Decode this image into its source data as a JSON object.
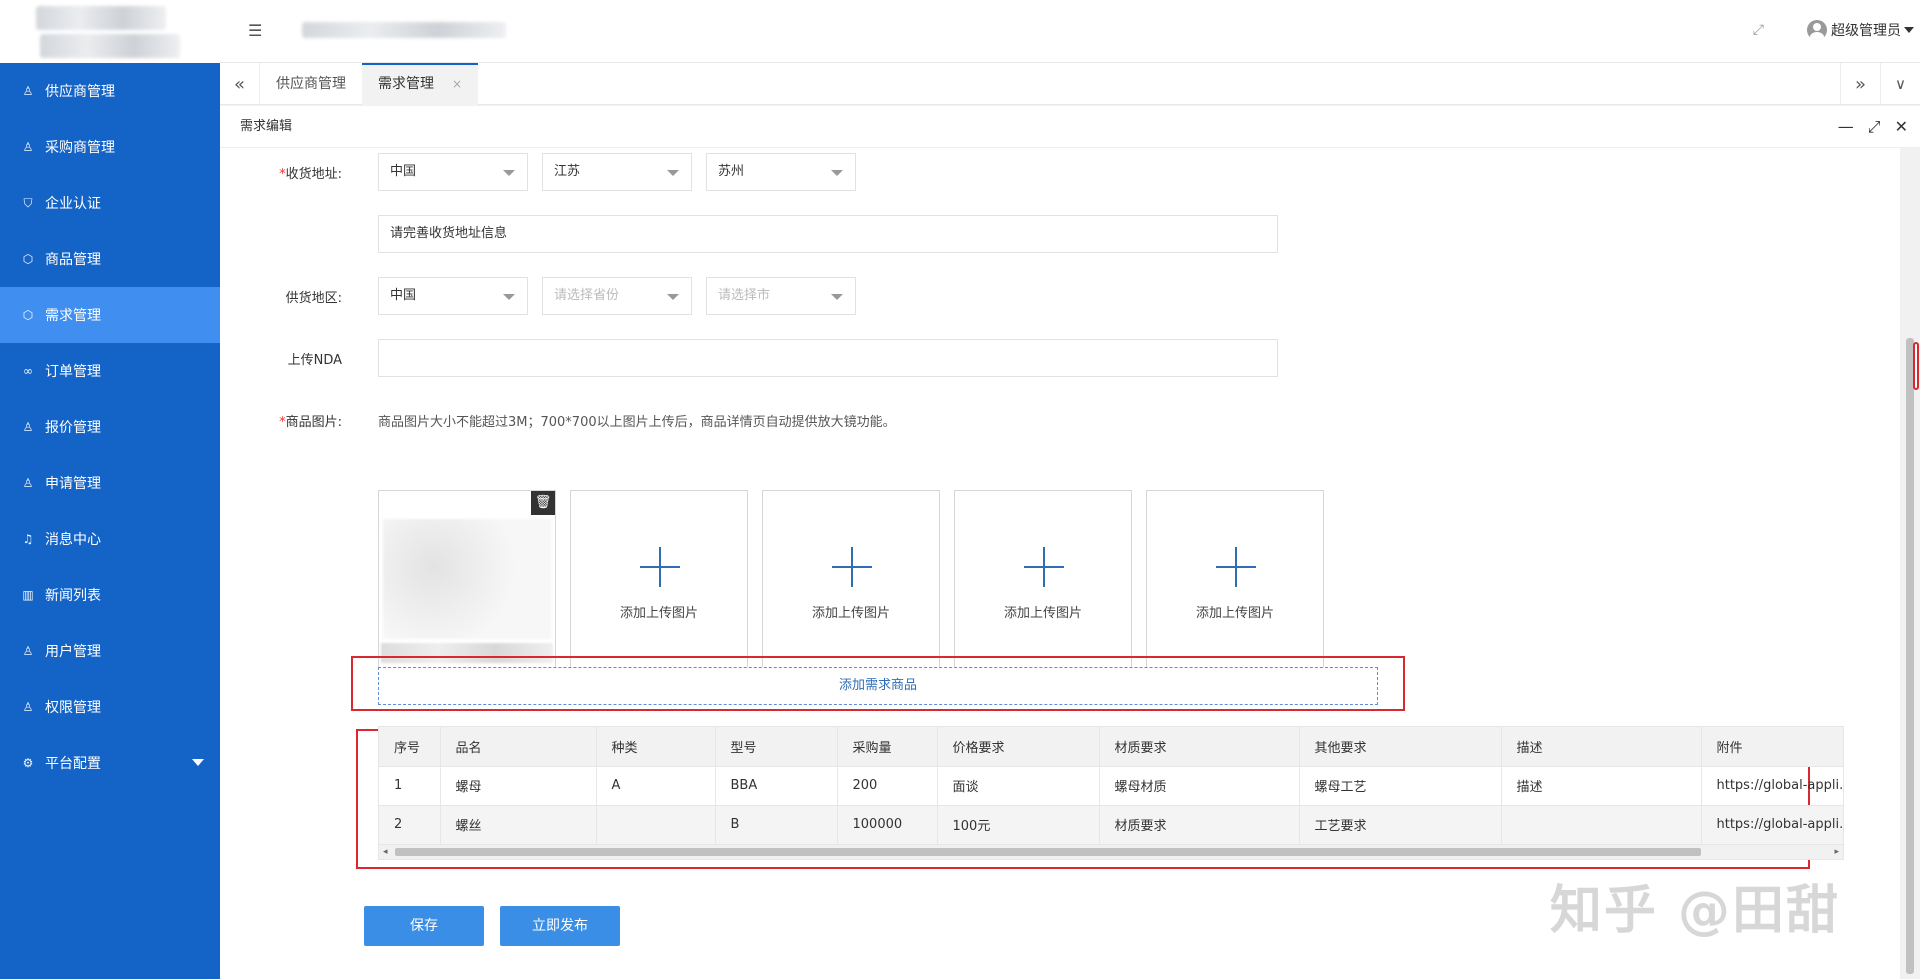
{
  "sidebar": {
    "items": [
      {
        "label": "供应商管理",
        "icon": "user-icon",
        "glyph": "♙"
      },
      {
        "label": "采购商管理",
        "icon": "user-icon",
        "glyph": "♙"
      },
      {
        "label": "企业认证",
        "icon": "shield-icon",
        "glyph": "⛉"
      },
      {
        "label": "商品管理",
        "icon": "cube-icon",
        "glyph": "⬡"
      },
      {
        "label": "需求管理",
        "icon": "cube-icon",
        "glyph": "⬡"
      },
      {
        "label": "订单管理",
        "icon": "infinity-icon",
        "glyph": "∞"
      },
      {
        "label": "报价管理",
        "icon": "user-icon",
        "glyph": "♙"
      },
      {
        "label": "申请管理",
        "icon": "user-icon",
        "glyph": "♙"
      },
      {
        "label": "消息中心",
        "icon": "bell-icon",
        "glyph": "♫"
      },
      {
        "label": "新闻列表",
        "icon": "book-icon",
        "glyph": "▥"
      },
      {
        "label": "用户管理",
        "icon": "users-icon",
        "glyph": "♙"
      },
      {
        "label": "权限管理",
        "icon": "user-icon",
        "glyph": "♙"
      },
      {
        "label": "平台配置",
        "icon": "gear-icon",
        "glyph": "⚙"
      }
    ],
    "active_index": 4
  },
  "header": {
    "menu_toggle_glyph": "☰",
    "fullscreen_glyph": "⤢",
    "user_name": "超级管理员"
  },
  "tabs": {
    "prev_glyph": "«",
    "next_glyph": "»",
    "more_glyph": "∨",
    "items": [
      {
        "label": "供应商管理"
      },
      {
        "label": "需求管理",
        "close": "×"
      }
    ]
  },
  "panel": {
    "title": "需求编辑",
    "ctrl_min": "—",
    "ctrl_max": "⤢",
    "ctrl_close": "✕"
  },
  "form": {
    "address_label": "收货地址:",
    "country": "中国",
    "province": "江苏",
    "city": "苏州",
    "address_detail": "请完善收货地址信息",
    "supply_label": "供货地区:",
    "supply_country": "中国",
    "supply_province_placeholder": "请选择省份",
    "supply_city_placeholder": "请选择市",
    "nda_label": "上传NDA",
    "image_label": "商品图片:",
    "image_hint": "商品图片大小不能超过3M；700*700以上图片上传后，商品详情页自动提供放大镜功能。",
    "add_image_text": "添加上传图片",
    "trash_glyph": "🗑",
    "add_goods_btn": "添加需求商品"
  },
  "table": {
    "columns": [
      "序号",
      "品名",
      "种类",
      "型号",
      "采购量",
      "价格要求",
      "材质要求",
      "其他要求",
      "描述",
      "附件"
    ],
    "rows": [
      [
        "1",
        "螺母",
        "A",
        "BBA",
        "200",
        "面谈",
        "螺母材质",
        "螺母工艺",
        "描述",
        "https://global-appli..."
      ],
      [
        "2",
        "螺丝",
        "",
        "B",
        "100000",
        "100元",
        "材质要求",
        "工艺要求",
        "",
        "https://global-appli..."
      ]
    ]
  },
  "buttons": {
    "save": "保存",
    "publish": "立即发布"
  },
  "watermark": "知乎 @田甜"
}
